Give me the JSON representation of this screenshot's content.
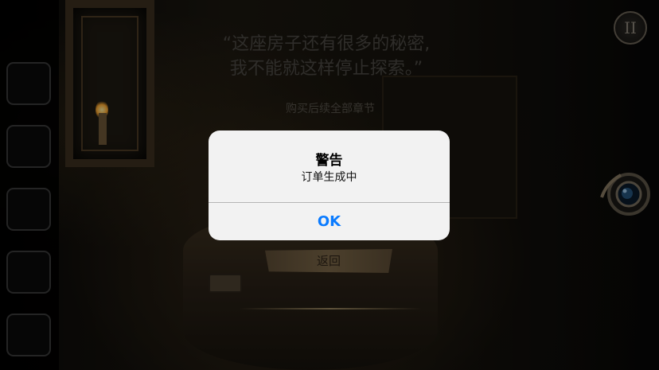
{
  "game": {
    "quote_line1": "“这座房子还有很多的秘密,",
    "quote_line2": "我不能就这样停止探索。”",
    "buy_text": "购买后续全部章节",
    "back_label": "返回",
    "pause_symbol": "II",
    "inventory_slots": 5,
    "icons": {
      "pause": "pause-icon",
      "camera": "camera-lens-icon"
    }
  },
  "alert": {
    "title": "警告",
    "message": "订单生成中",
    "ok_label": "OK",
    "ok_color": "#0a7bff"
  }
}
